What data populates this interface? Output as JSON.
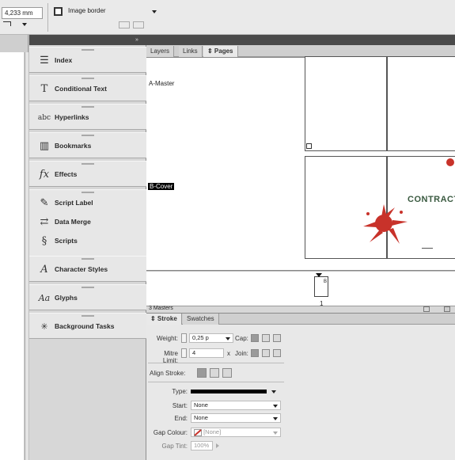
{
  "control_bar": {
    "measure_value": "4,233 mm",
    "object_style_value": "Image border"
  },
  "panel_dock": {
    "items": [
      {
        "label": "Index",
        "icon": "index-icon"
      },
      {
        "label": "Conditional Text",
        "icon": "conditional-text-icon"
      },
      {
        "label": "Hyperlinks",
        "icon": "hyperlinks-icon"
      },
      {
        "label": "Bookmarks",
        "icon": "bookmarks-icon"
      },
      {
        "label": "Effects",
        "icon": "effects-icon"
      },
      {
        "label": "Script Label",
        "icon": "script-label-icon"
      },
      {
        "label": "Data Merge",
        "icon": "data-merge-icon"
      },
      {
        "label": "Scripts",
        "icon": "scripts-icon"
      },
      {
        "label": "Character Styles",
        "icon": "character-styles-icon"
      },
      {
        "label": "Glyphs",
        "icon": "glyphs-icon"
      },
      {
        "label": "Background Tasks",
        "icon": "background-tasks-icon"
      }
    ]
  },
  "pages_panel": {
    "tabs": [
      "Layers",
      "Links",
      "⇕ Pages"
    ],
    "master_a": "A-Master",
    "master_b": "B-Cover",
    "cover_text": "CONTRACTS",
    "page_number": "1",
    "masters_count": "3 Masters"
  },
  "stroke_panel": {
    "tabs": [
      "⇕ Stroke",
      "Swatches"
    ],
    "weight_label": "Weight:",
    "weight_value": "0,25 p",
    "cap_label": "Cap:",
    "miter_label": "Mitre Limit:",
    "miter_value": "4",
    "miter_x": "x",
    "join_label": "Join:",
    "align_label": "Align Stroke:",
    "type_label": "Type:",
    "start_label": "Start:",
    "start_value": "None",
    "end_label": "End:",
    "end_value": "None",
    "gap_colour_label": "Gap Colour:",
    "gap_colour_value": "[None]",
    "gap_tint_label": "Gap Tint:",
    "gap_tint_value": "100%"
  },
  "colors": {
    "accent_red": "#c8322a",
    "selected_master_bg": "#000000"
  }
}
